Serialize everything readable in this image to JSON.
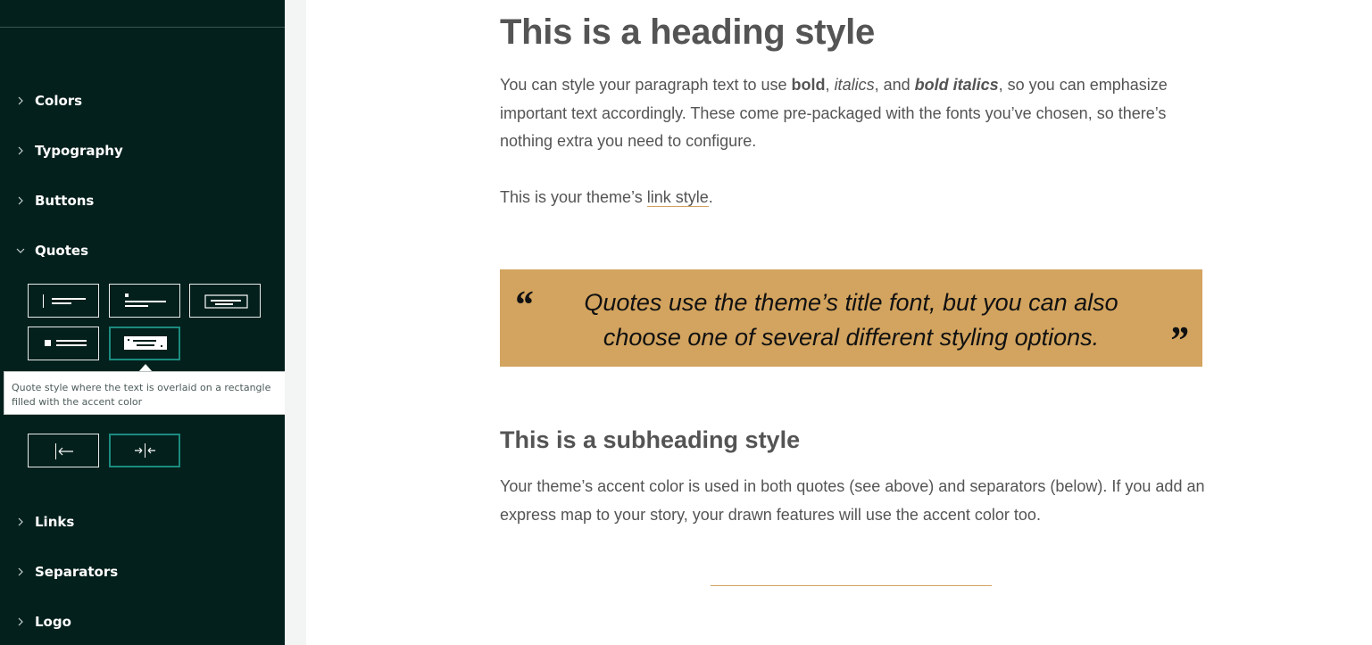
{
  "sidebar": {
    "sections": [
      {
        "label": "Colors",
        "icon": "chevron-right-icon"
      },
      {
        "label": "Typography",
        "icon": "chevron-right-icon"
      },
      {
        "label": "Buttons",
        "icon": "chevron-right-icon"
      },
      {
        "label": "Quotes",
        "icon": "chevron-down-icon"
      },
      {
        "label": "Links",
        "icon": "chevron-right-icon"
      },
      {
        "label": "Separators",
        "icon": "chevron-right-icon"
      },
      {
        "label": "Logo",
        "icon": "chevron-right-icon"
      }
    ],
    "quote_styles": [
      {
        "name": "quote-style-bar"
      },
      {
        "name": "quote-style-dot"
      },
      {
        "name": "quote-style-box"
      },
      {
        "name": "quote-style-block"
      },
      {
        "name": "quote-style-accent-fill",
        "selected": true
      }
    ],
    "tooltip": "Quote style where the text is overlaid on a rectangle filled with the accent color",
    "alignment_options": [
      {
        "name": "align-left-icon"
      },
      {
        "name": "align-center-icon",
        "selected": true
      }
    ]
  },
  "main": {
    "heading": "This is a heading style",
    "para1": {
      "before_bold": "You can style your paragraph text to use ",
      "bold": "bold",
      "sep1": ", ",
      "italic": "italics",
      "sep2": ", and ",
      "bold_italic": "bold italics",
      "after": ", so you can emphasize important text accordingly. These come pre-packaged with the fonts you’ve chosen, so there’s nothing extra you need to configure."
    },
    "link_para": {
      "before": "This is your theme’s ",
      "link": "link style",
      "after": "."
    },
    "quote": {
      "open_mark": "“",
      "text": "Quotes use the theme’s title font, but you can also choose one of several different styling options.",
      "close_mark": "”"
    },
    "subheading": "This is a subheading style",
    "para2": "Your theme’s accent color is used in both quotes (see above) and separators (below). If you add an express map to your story, your drawn features will use the accent color too."
  },
  "colors": {
    "sidebar_bg": "#03201c",
    "accent": "#d3a45f",
    "selected_border": "#1b8b7f",
    "text": "#545454"
  }
}
